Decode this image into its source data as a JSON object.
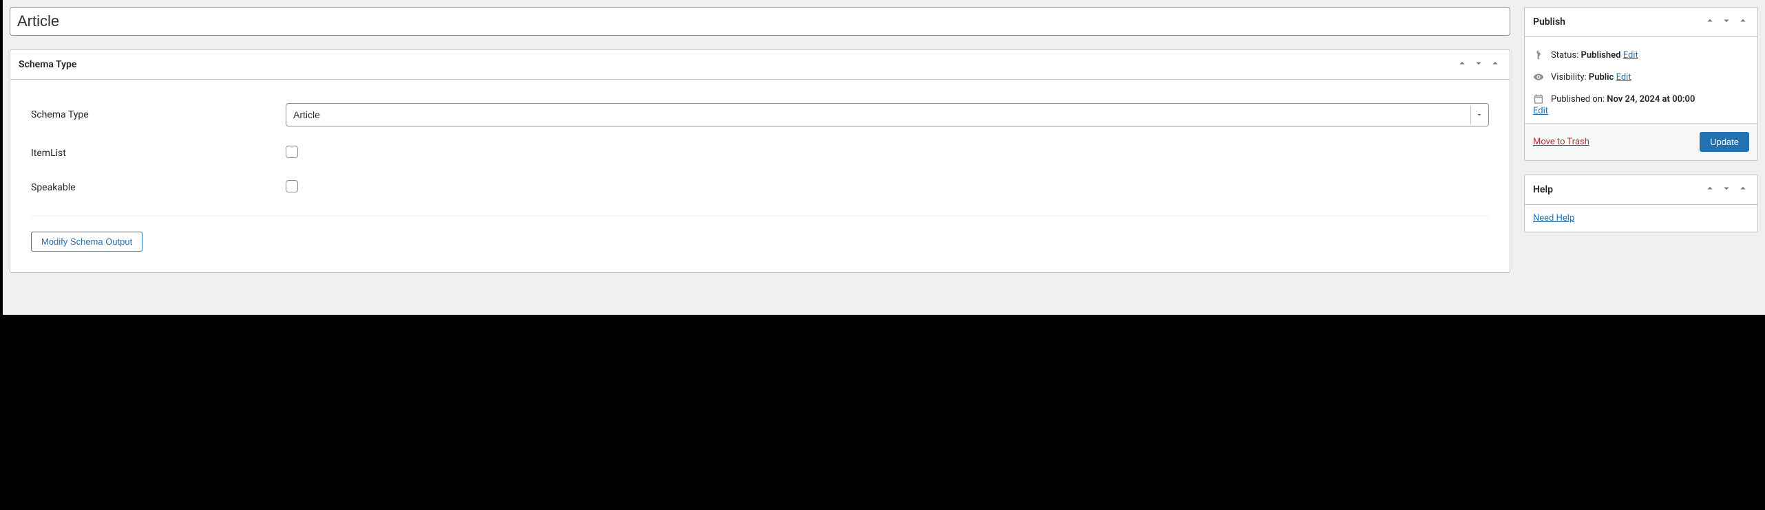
{
  "title_value": "Article",
  "schema_box": {
    "title": "Schema Type",
    "fields": {
      "schema_type_label": "Schema Type",
      "schema_type_value": "Article",
      "itemlist_label": "ItemList",
      "speakable_label": "Speakable"
    },
    "modify_button": "Modify Schema Output"
  },
  "publish_box": {
    "title": "Publish",
    "status_label": "Status: ",
    "status_value": "Published",
    "status_edit": "Edit",
    "visibility_label": "Visibility: ",
    "visibility_value": "Public",
    "visibility_edit": "Edit",
    "published_label": "Published on: ",
    "published_value": "Nov 24, 2024 at 00:00",
    "published_edit": "Edit",
    "trash_label": "Move to Trash",
    "update_label": "Update"
  },
  "help_box": {
    "title": "Help",
    "link": "Need Help"
  }
}
